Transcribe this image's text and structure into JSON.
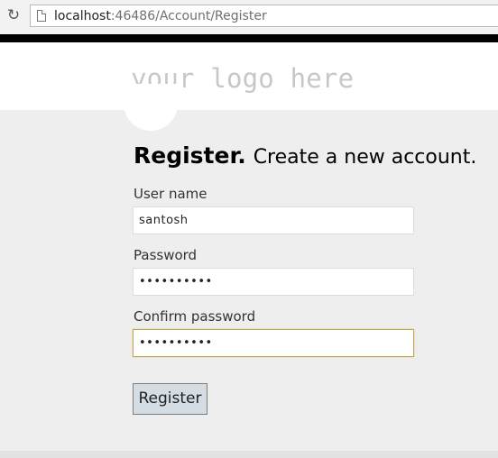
{
  "browser": {
    "url_host": "localhost",
    "url_rest": ":46486/Account/Register",
    "reload_icon": "reload-icon",
    "page_icon": "page-icon"
  },
  "header": {
    "logo_text": "your logo here"
  },
  "form": {
    "title_strong": "Register.",
    "title_sub": "Create a new account.",
    "username_label": "User name",
    "username_value": "santosh",
    "password_label": "Password",
    "password_value": "••••••••••",
    "confirm_label": "Confirm password",
    "confirm_value": "••••••••••",
    "submit_label": "Register"
  },
  "colors": {
    "focus_border": "#c8a84b",
    "button_bg": "#d3dde3",
    "page_bg": "#efeeef"
  }
}
